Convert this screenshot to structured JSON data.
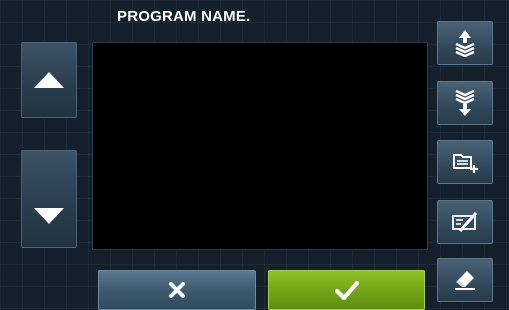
{
  "header": {
    "title": "PROGRAM NAME."
  },
  "display": {
    "text": ""
  },
  "scroll": {
    "up_icon": "triangle-up-icon",
    "down_icon": "triangle-down-icon"
  },
  "side_buttons": [
    {
      "name": "move-up-button",
      "icon": "stack-arrow-up-icon"
    },
    {
      "name": "move-down-button",
      "icon": "stack-arrow-down-icon"
    },
    {
      "name": "add-folder-button",
      "icon": "folder-add-icon"
    },
    {
      "name": "edit-name-button",
      "icon": "rename-icon"
    },
    {
      "name": "eraser-button",
      "icon": "eraser-icon"
    }
  ],
  "bottom_buttons": {
    "cancel_icon": "close-icon",
    "confirm_icon": "check-icon"
  },
  "colors": {
    "background": "#14212d",
    "confirm": "#74a616",
    "cancel": "#3f5a70",
    "display": "#000000"
  }
}
